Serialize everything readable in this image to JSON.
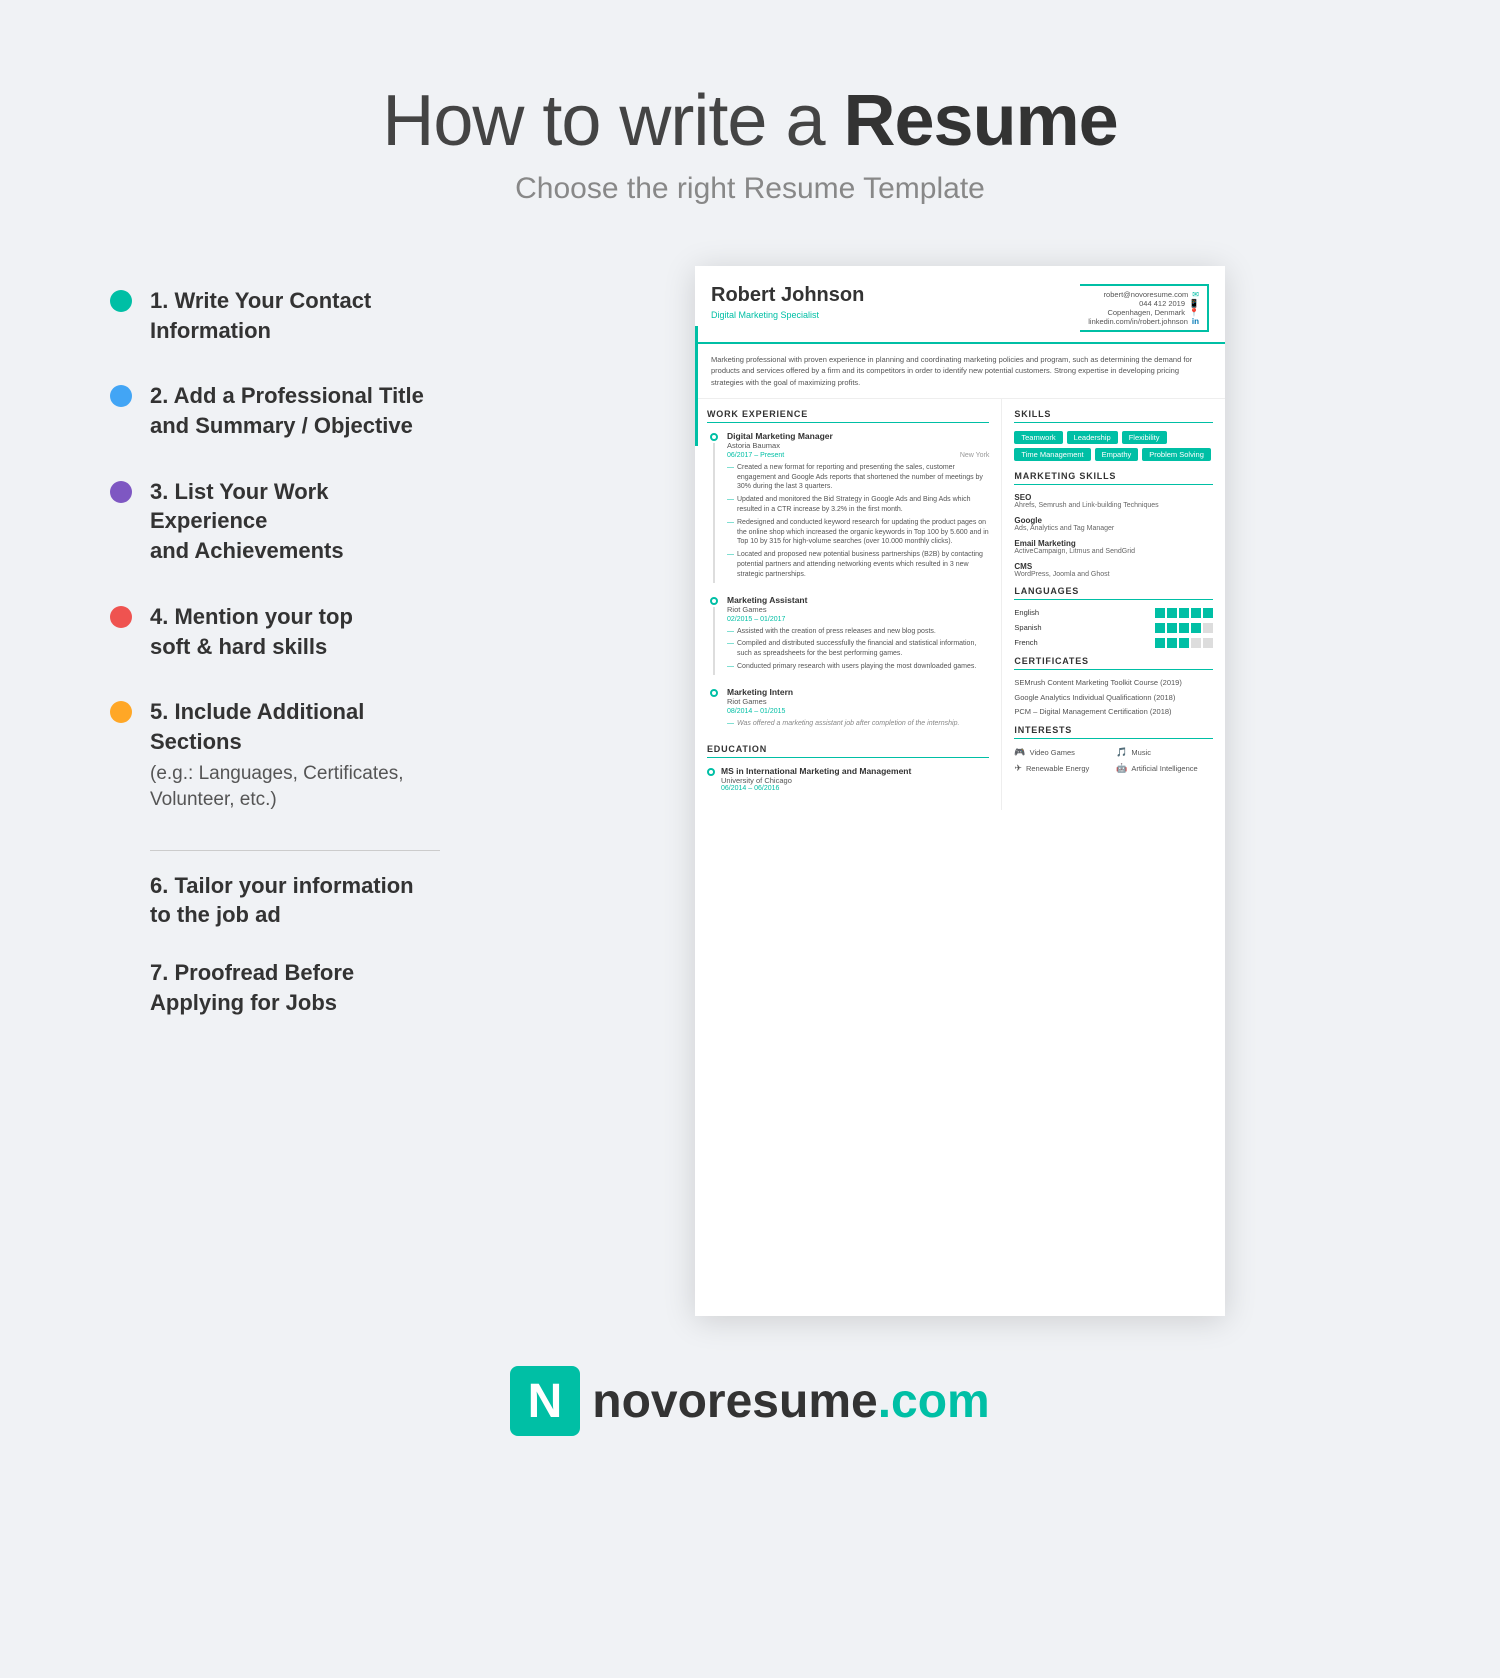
{
  "header": {
    "title_light": "How to write a",
    "title_bold": "Resume",
    "subtitle": "Choose the right Resume Template"
  },
  "steps": [
    {
      "number": "1",
      "text": "1. Write Your Contact Information",
      "sub": "",
      "dot_class": "dot-teal"
    },
    {
      "number": "2",
      "text": "2. Add a Professional Title and Summary / Objective",
      "sub": "",
      "dot_class": "dot-blue"
    },
    {
      "number": "3",
      "text": "3. List Your Work Experience and Achievements",
      "sub": "",
      "dot_class": "dot-purple"
    },
    {
      "number": "4",
      "text": "4. Mention your top soft & hard skills",
      "sub": "",
      "dot_class": "dot-red"
    },
    {
      "number": "5",
      "text": "5. Include Additional Sections",
      "sub": "(e.g.: Languages, Certificates, Volunteer, etc.)",
      "dot_class": "dot-orange"
    }
  ],
  "steps_after": [
    {
      "text": "6. Tailor your information to the job ad"
    },
    {
      "text": "7. Proofread Before Applying for Jobs"
    }
  ],
  "resume": {
    "name": "Robert Johnson",
    "title": "Digital Marketing Specialist",
    "contact": {
      "email": "robert@novoresume.com",
      "phone": "044 412 2019",
      "location": "Copenhagen, Denmark",
      "linkedin": "linkedin.com/in/robert.johnson"
    },
    "summary": "Marketing professional with proven experience in planning and coordinating marketing policies and program, such as determining the demand for products and services offered by a firm and its competitors in order to identify new potential customers. Strong expertise in developing pricing strategies with the goal of maximizing profits.",
    "work_experience": [
      {
        "title": "Digital Marketing Manager",
        "company": "Astoria Baumax",
        "dates": "06/2017 – Present",
        "location": "New York",
        "bullets": [
          "Created a new format for reporting and presenting the sales, customer engagement and Google Ads reports that shortened the number of meetings by 30% during the last 3 quarters.",
          "Updated and monitored the Bid Strategy in Google Ads and Bing Ads which resulted in a CTR increase by 3.2% in the first month.",
          "Redesigned and conducted keyword research for updating the product pages on the online shop which increased the organic keywords in Top 100 by 5.600 and in Top 10 by 315 for high-volume searches (over 10.000 monthly clicks).",
          "Located and proposed new potential business partnerships (B2B) by contacting potential partners and attending networking events which resulted in 3 new strategic partnerships."
        ]
      },
      {
        "title": "Marketing Assistant",
        "company": "Riot Games",
        "dates": "02/2015 – 01/2017",
        "location": "",
        "bullets": [
          "Assisted with the creation of press releases and new blog posts.",
          "Compiled and distributed successfully the financial and statistical information, such as spreadsheets for the best performing games.",
          "Conducted primary research with users playing the most downloaded games."
        ]
      },
      {
        "title": "Marketing Intern",
        "company": "Riot Games",
        "dates": "08/2014 – 01/2015",
        "location": "",
        "bullets": [
          "Was offered a marketing assistant job after completion of the internship."
        ],
        "italic": true
      }
    ],
    "education": [
      {
        "degree": "MS in International Marketing and Management",
        "school": "University of Chicago",
        "dates": "06/2014 – 06/2016"
      }
    ],
    "skills": {
      "tags": [
        "Teamwork",
        "Leadership",
        "Flexibility",
        "Time Management",
        "Empathy",
        "Problem Solving"
      ]
    },
    "marketing_skills": [
      {
        "title": "SEO",
        "desc": "Ahrefs, Semrush and Link-building Techniques"
      },
      {
        "title": "Google",
        "desc": "Ads, Analytics and Tag Manager"
      },
      {
        "title": "Email Marketing",
        "desc": "ActiveCampaign, Litmus and SendGrid"
      },
      {
        "title": "CMS",
        "desc": "WordPress, Joomla and Ghost"
      }
    ],
    "languages": [
      {
        "name": "English",
        "level": 5
      },
      {
        "name": "Spanish",
        "level": 4
      },
      {
        "name": "French",
        "level": 3
      }
    ],
    "certificates": [
      "SEMrush Content Marketing Toolkit Course (2019)",
      "Google Analytics Individual Qualificationn (2018)",
      "PCM – Digital Management Certification (2018)"
    ],
    "interests": [
      {
        "icon": "🎮",
        "label": "Video Games"
      },
      {
        "icon": "🎵",
        "label": "Music"
      },
      {
        "icon": "✈",
        "label": "Renewable Energy"
      },
      {
        "icon": "🤖",
        "label": "Artificial Intelligence"
      }
    ]
  },
  "footer": {
    "brand_name": "novoresume",
    "brand_tld": ".com"
  }
}
